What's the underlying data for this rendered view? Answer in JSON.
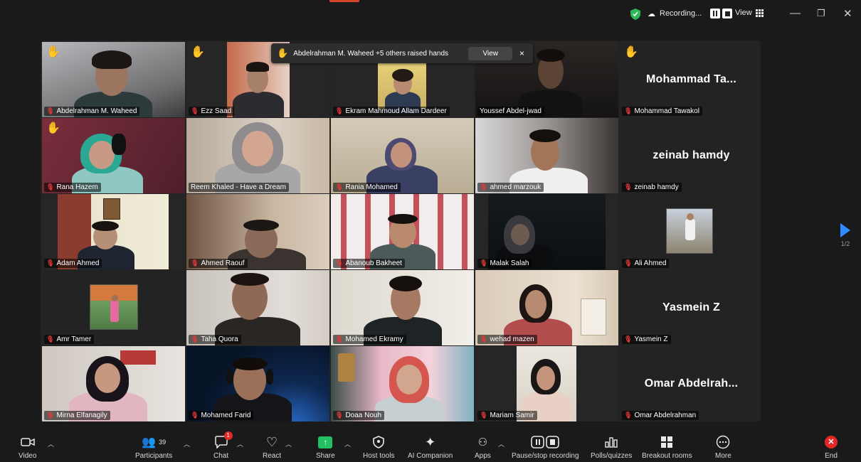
{
  "topbar": {
    "recording_label": "Recording...",
    "view_label": "View",
    "colors": {
      "shield": "#2eb857",
      "accent": "#d4452a"
    }
  },
  "notification": {
    "text": "Abdelrahman M. Waheed +5 others raised hands",
    "view_label": "View",
    "close_label": "×"
  },
  "pager": {
    "label": "1/2"
  },
  "tiles": [
    {
      "name": "Abdelrahman M. Waheed",
      "hand": true
    },
    {
      "name": "Ezz Saad",
      "hand": true
    },
    {
      "name": "Ekram Mahmoud Allam Dardeer",
      "hand": false
    },
    {
      "name": "Youssef Abdel-jwad",
      "hand": false,
      "active": true
    },
    {
      "name": "Mohammad Tawakol",
      "hand": true,
      "big": "Mohammad  Ta..."
    },
    {
      "name": "Rana Hazem",
      "hand": true
    },
    {
      "name": "Reem Khaled - Have a Dream",
      "hand": false
    },
    {
      "name": "Rania Mohamed",
      "hand": false
    },
    {
      "name": "ahmed marzouk",
      "hand": false
    },
    {
      "name": "zeinab hamdy",
      "hand": false,
      "big": "zeinab hamdy"
    },
    {
      "name": "Adam Ahmed",
      "hand": false
    },
    {
      "name": "Ahmed Raouf",
      "hand": false
    },
    {
      "name": "Abanoub Bakheet",
      "hand": false
    },
    {
      "name": "Malak Salah",
      "hand": false
    },
    {
      "name": "Ali Ahmed",
      "hand": false
    },
    {
      "name": "Amr Tamer",
      "hand": false
    },
    {
      "name": "Taha Quora",
      "hand": false
    },
    {
      "name": "Mohamed Ekramy",
      "hand": false
    },
    {
      "name": "wehad mazen",
      "hand": false
    },
    {
      "name": "Yasmein Z",
      "hand": false,
      "big": "Yasmein Z"
    },
    {
      "name": "Mirna Elfanagily",
      "hand": false
    },
    {
      "name": "Mohamed Farid",
      "hand": false
    },
    {
      "name": "Doaa Nouh",
      "hand": false
    },
    {
      "name": "Mariam Samir",
      "hand": false
    },
    {
      "name": "Omar Abdelrahman",
      "hand": false,
      "big": "Omar  Abdelrah..."
    }
  ],
  "toolbar": {
    "video": "Video",
    "participants": "Participants",
    "participants_count": "39",
    "chat": "Chat",
    "chat_badge": "1",
    "react": "React",
    "share": "Share",
    "host_tools": "Host tools",
    "ai_companion": "AI Companion",
    "apps": "Apps",
    "pause_recording": "Pause/stop recording",
    "polls": "Polls/quizzes",
    "breakout": "Breakout rooms",
    "more": "More",
    "end": "End",
    "colors": {
      "share": "#23c064",
      "end": "#e02828"
    }
  }
}
